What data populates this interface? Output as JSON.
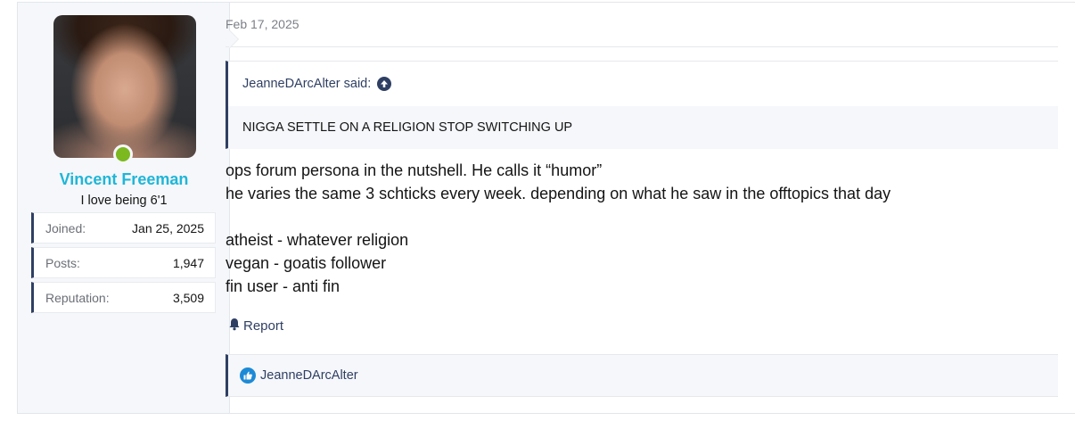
{
  "author": {
    "username": "Vincent Freeman",
    "user_title": "I love being 6'1",
    "status": "online",
    "stats": [
      {
        "label": "Joined:",
        "value": "Jan 25, 2025"
      },
      {
        "label": "Posts:",
        "value": "1,947"
      },
      {
        "label": "Reputation:",
        "value": "3,509"
      }
    ]
  },
  "post": {
    "date": "Feb 17, 2025",
    "quote": {
      "attribution": "JeanneDArcAlter said:",
      "text": "NIGGA SETTLE ON A RELIGION STOP SWITCHING UP"
    },
    "message_lines": [
      "ops forum persona in the nutshell. He calls it “humor”",
      "he varies the same 3 schticks every week. depending on what he saw in the offtopics that day",
      "",
      "atheist - whatever religion",
      "vegan - goatis follower",
      "fin user - anti fin"
    ],
    "report_label": "Report",
    "reactions": {
      "icon": "like-icon",
      "users": "JeanneDArcAlter"
    }
  },
  "colors": {
    "username": "#1fb6d8",
    "accent": "#2f3f63",
    "online": "#7cb81f",
    "like": "#1d8ad6"
  }
}
